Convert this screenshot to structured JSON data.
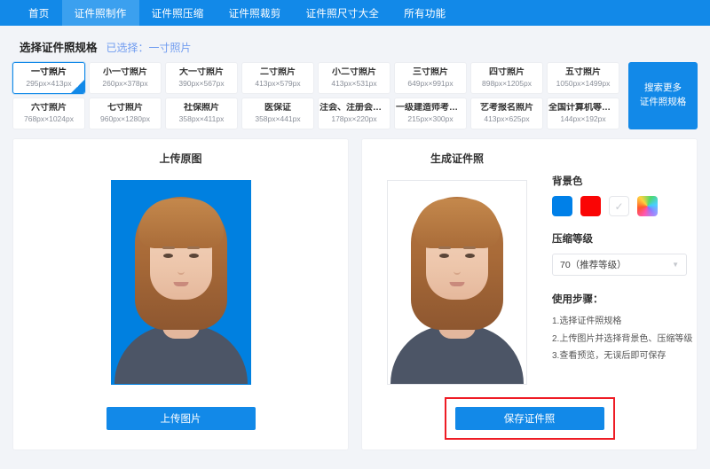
{
  "nav": {
    "tabs": [
      {
        "label": "首页",
        "active": false
      },
      {
        "label": "证件照制作",
        "active": true
      },
      {
        "label": "证件照压缩",
        "active": false
      },
      {
        "label": "证件照裁剪",
        "active": false
      },
      {
        "label": "证件照尺寸大全",
        "active": false
      },
      {
        "label": "所有功能",
        "active": false
      }
    ]
  },
  "spec_section": {
    "title": "选择证件照规格",
    "selected_text": "已选择：一寸照片",
    "search_more": {
      "line1": "搜索更多",
      "line2": "证件照规格"
    },
    "check_icon": "✓",
    "items": [
      {
        "name": "一寸照片",
        "size": "295px×413px",
        "selected": true
      },
      {
        "name": "小一寸照片",
        "size": "260px×378px",
        "selected": false
      },
      {
        "name": "大一寸照片",
        "size": "390px×567px",
        "selected": false
      },
      {
        "name": "二寸照片",
        "size": "413px×579px",
        "selected": false
      },
      {
        "name": "小二寸照片",
        "size": "413px×531px",
        "selected": false
      },
      {
        "name": "三寸照片",
        "size": "649px×991px",
        "selected": false
      },
      {
        "name": "四寸照片",
        "size": "898px×1205px",
        "selected": false
      },
      {
        "name": "五寸照片",
        "size": "1050px×1499px",
        "selected": false
      },
      {
        "name": "六寸照片",
        "size": "768px×1024px",
        "selected": false
      },
      {
        "name": "七寸照片",
        "size": "960px×1280px",
        "selected": false
      },
      {
        "name": "社保照片",
        "size": "358px×411px",
        "selected": false
      },
      {
        "name": "医保证",
        "size": "358px×441px",
        "selected": false
      },
      {
        "name": "注会、注册会计...",
        "size": "178px×220px",
        "selected": false
      },
      {
        "name": "一级建造师考试...",
        "size": "215px×300px",
        "selected": false
      },
      {
        "name": "艺考报名照片",
        "size": "413px×625px",
        "selected": false
      },
      {
        "name": "全国计算机等级...",
        "size": "144px×192px",
        "selected": false
      }
    ]
  },
  "left_panel": {
    "title": "上传原图",
    "button_label": "上传图片",
    "photo_background": "#0080e0"
  },
  "right_panel": {
    "title": "生成证件照",
    "button_label": "保存证件照",
    "photo_background": "#ffffff",
    "background_color": {
      "label": "背景色",
      "swatches": [
        {
          "name": "blue-swatch",
          "color": "#0080e8",
          "selected": false
        },
        {
          "name": "red-swatch",
          "color": "#fa0505",
          "selected": false
        },
        {
          "name": "white-swatch",
          "color": "#ffffff",
          "selected": true
        },
        {
          "name": "custom-color-swatch",
          "color": "rainbow",
          "selected": false
        }
      ],
      "check_mark": "✓"
    },
    "compression": {
      "label": "压缩等级",
      "value": "70（推荐等级）",
      "caret": "▼"
    },
    "steps": {
      "title": "使用步骤：",
      "items": [
        "1.选择证件照规格",
        "2.上传图片并选择背景色、压缩等级",
        "3.查看预览，无误后即可保存"
      ]
    }
  },
  "annotation": {
    "color": "#ee1c25"
  }
}
